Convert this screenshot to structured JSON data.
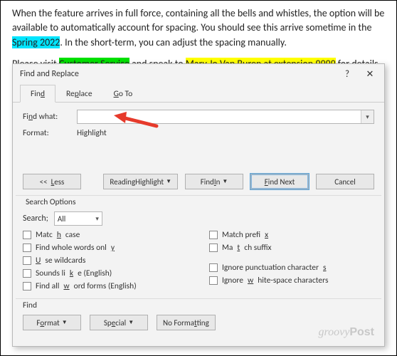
{
  "document": {
    "p1_a": "When the feature arrives in full force, containing all the bells and whistles, the option will be available to automatically account for spacing. You should see this arrive sometime in the ",
    "p1_hl": "Spring 2022",
    "p1_b": ". In the short-term, you can adjust the spacing manually.",
    "p2_a": "Please visit ",
    "p2_hl1": "Customer Service",
    "p2_b": " and speak to ",
    "p2_hl2": "Mary Jo Van Buren at extension 9999",
    "p2_c": " for details."
  },
  "dialog": {
    "title": "Find and Replace",
    "help": "?",
    "close": "✕",
    "tabs": {
      "find": "Find",
      "replace": "Replace",
      "goto": "Go To"
    },
    "labels": {
      "findwhat": "Find what:",
      "format": "Format:"
    },
    "format_value": "Highlight",
    "buttons": {
      "less": "<<  Less",
      "reading": "Reading Highlight",
      "findin": "Find In",
      "findnext": "Find Next",
      "cancel": "Cancel"
    },
    "search_options": {
      "header": "Search Options",
      "search_label": "Search;",
      "search_value": "All",
      "left": [
        "Match case",
        "Find whole words only",
        "Use wildcards",
        "Sounds like (English)",
        "Find all word forms (English)"
      ],
      "right": [
        "Match prefix",
        "Match suffix",
        "Ignore punctuation characters",
        "Ignore white-space characters"
      ]
    },
    "find_section": {
      "header": "Find",
      "format": "Format",
      "special": "Special",
      "noformat": "No Formatting"
    }
  },
  "brand": {
    "a": "groovy",
    "b": "Post"
  },
  "underline_map": {
    "find": "d",
    "replace": "p",
    "goto": "G",
    "findwhat": "n",
    "less": "L",
    "reading": "g",
    "findin": "I",
    "findnext": "F",
    "match_case": "H",
    "whole": "Y",
    "wild": "U",
    "sounds": "K",
    "allword": "w",
    "prefix": "x",
    "suffix": "T",
    "punct": "S",
    "white": "W",
    "format_btn": "o",
    "special": "e",
    "noformat": "T",
    "search": "S"
  }
}
